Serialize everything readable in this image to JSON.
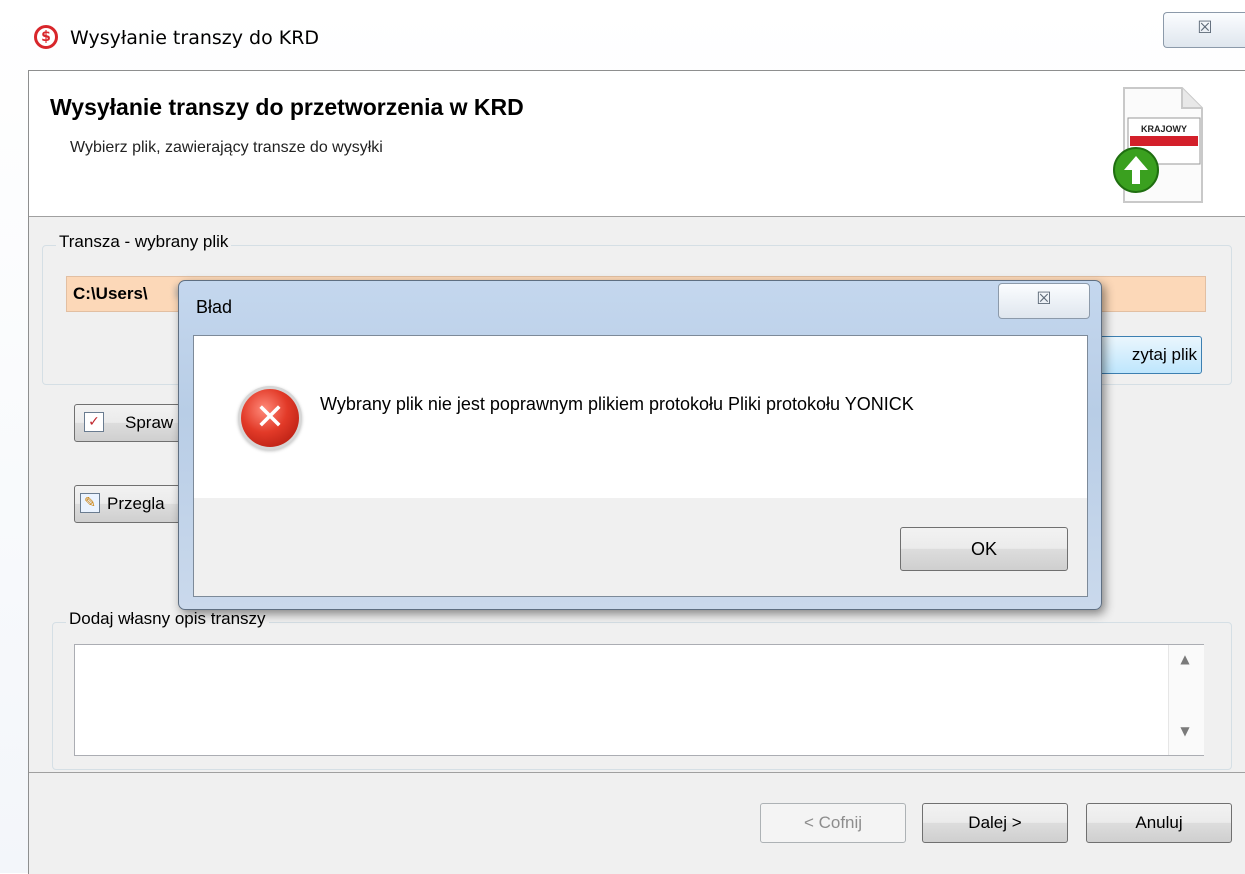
{
  "window": {
    "title": "Wysyłanie transzy do KRD",
    "close_glyph": "☒",
    "app_icon": "krd-app-icon"
  },
  "header": {
    "title": "Wysyłanie transzy do przetworzenia w KRD",
    "subtitle": "Wybierz plik, zawierający transze do wysyłki",
    "logo_text": "KRAJOWY",
    "icon": "upload-document-icon"
  },
  "file_group": {
    "legend": "Transza - wybrany plik",
    "path_value": "C:\\Users\\",
    "read_button": "zytaj plik"
  },
  "actions": {
    "check_button": "Spraw",
    "check_icon": "check-document-icon",
    "preview_button": "Przegla",
    "preview_icon": "edit-document-icon"
  },
  "description_group": {
    "legend": "Dodaj własny opis transzy",
    "value": ""
  },
  "footer": {
    "back_button": "< Cofnij",
    "next_button": "Dalej >",
    "cancel_button": "Anuluj"
  },
  "dialog": {
    "title": "Bład",
    "close_glyph": "☒",
    "message": "Wybrany plik nie jest poprawnym plikiem protokołu Pliki protokołu YONICK",
    "ok_button": "OK",
    "icon": "error-icon"
  }
}
